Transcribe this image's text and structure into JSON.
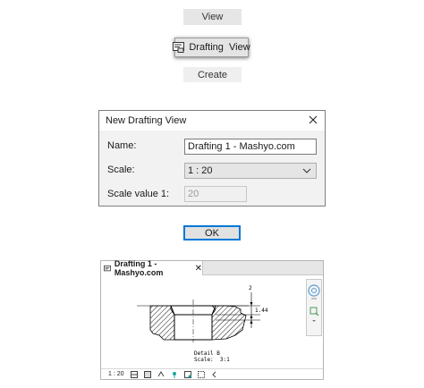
{
  "ribbon": {
    "tab_label": "View",
    "drafting_view_label": "Drafting  View",
    "panel_label": "Create"
  },
  "dialog": {
    "title": "New Drafting View",
    "name_label": "Name:",
    "name_value": "Drafting 1 - Mashyo.com",
    "scale_label": "Scale:",
    "scale_value": "1 : 20",
    "scale_value_label": "Scale value  1:",
    "scale_value_number": "20"
  },
  "ok_label": "OK",
  "view_window": {
    "tab_title": "Drafting 1 - Mashyo.com",
    "tab_close": "✕",
    "drawing": {
      "dim_top": "2",
      "dim_side": "1.44",
      "detail_title": "Detail B",
      "detail_scale": "Scale:  3:1"
    },
    "status_scale": "1 : 20"
  },
  "colors": {
    "accent": "#0078d7",
    "hatch": "#000000",
    "nav_icon": "#5a9bd5"
  }
}
